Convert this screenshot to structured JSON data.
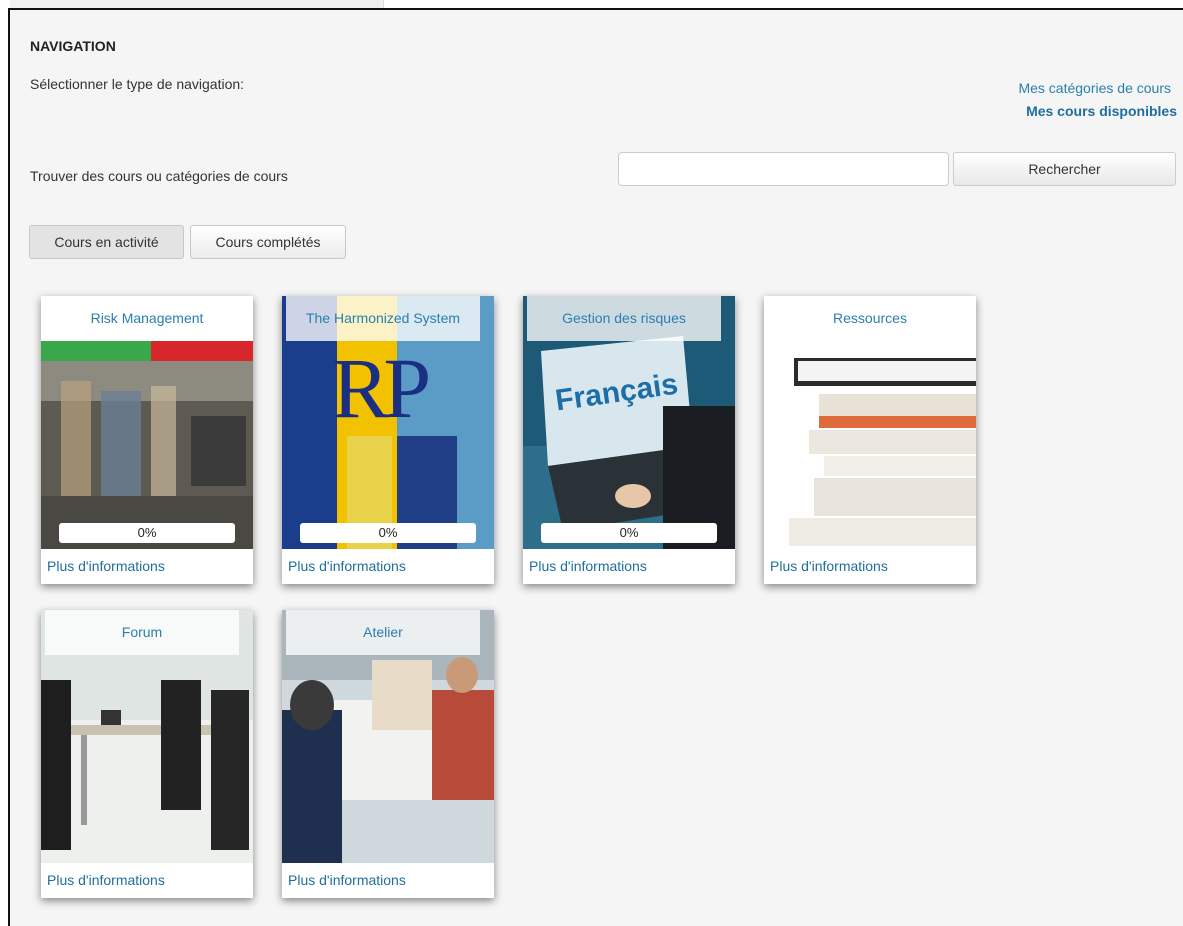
{
  "navigation": {
    "title": "NAVIGATION",
    "select_label": "Sélectionner le type de navigation:",
    "link_categories": "Mes catégories de cours",
    "link_available": "Mes cours disponibles"
  },
  "search": {
    "label": "Trouver des cours ou catégories de cours",
    "value": "",
    "button": "Rechercher"
  },
  "tabs": {
    "active": "Cours en activité",
    "completed": "Cours complétés"
  },
  "courses": [
    {
      "title": "Risk Management",
      "progress": "0%",
      "more": "Plus d'informations"
    },
    {
      "title": "The Harmonized System",
      "image_text": "RP",
      "progress": "0%",
      "more": "Plus d'informations"
    },
    {
      "title": "Gestion des risques",
      "image_text": "Français",
      "progress": "0%",
      "more": "Plus d'informations"
    },
    {
      "title": "Ressources",
      "more": "Plus d'informations"
    },
    {
      "title": "Forum",
      "more": "Plus d'informations"
    },
    {
      "title": "Atelier",
      "more": "Plus d'informations"
    }
  ],
  "colors": {
    "link": "#2a7fb0",
    "panel_bg": "#f5f5f5"
  }
}
